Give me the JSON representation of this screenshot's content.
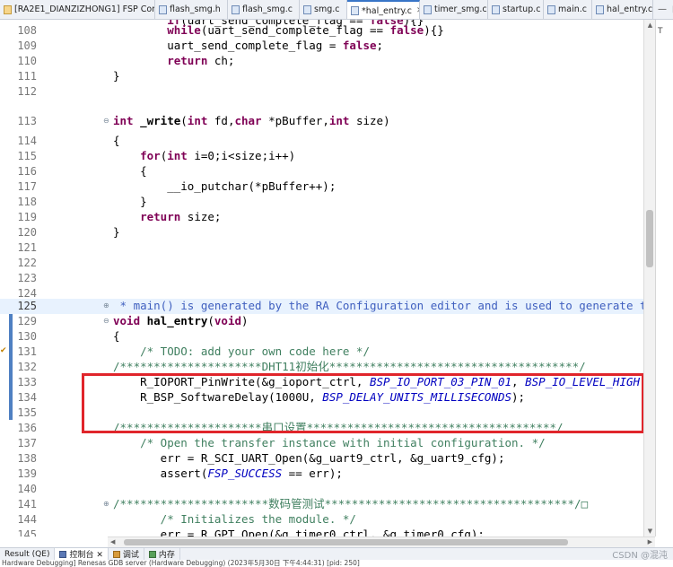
{
  "tabs": [
    {
      "label": "[RA2E1_DIANZIZHONG1] FSP Confi...",
      "icon": "config-icon",
      "active": false
    },
    {
      "label": "flash_smg.h",
      "icon": "c-header-icon",
      "active": false
    },
    {
      "label": "flash_smg.c",
      "icon": "c-file-icon",
      "active": false
    },
    {
      "label": "smg.c",
      "icon": "c-file-icon",
      "active": false
    },
    {
      "label": "*hal_entry.c",
      "icon": "c-file-icon",
      "active": true
    },
    {
      "label": "timer_smg.c",
      "icon": "c-file-icon",
      "active": false
    },
    {
      "label": "startup.c",
      "icon": "c-file-icon",
      "active": false
    },
    {
      "label": "main.c",
      "icon": "c-file-icon",
      "active": false
    },
    {
      "label": "hal_entry.c",
      "icon": "c-file-icon",
      "active": false
    }
  ],
  "tab_controls": {
    "minimize": "—",
    "maximize": "□"
  },
  "overview_label": "T",
  "code_lines": [
    {
      "num": "",
      "html_key": "l107"
    },
    {
      "num": "108"
    },
    {
      "num": "109"
    },
    {
      "num": "110"
    },
    {
      "num": "111"
    },
    {
      "num": "112"
    },
    {
      "num": ""
    },
    {
      "num": "113"
    },
    {
      "num": "114"
    },
    {
      "num": "115"
    },
    {
      "num": "116"
    },
    {
      "num": "117"
    },
    {
      "num": "118"
    },
    {
      "num": "119"
    },
    {
      "num": "120"
    },
    {
      "num": "121"
    },
    {
      "num": "122"
    },
    {
      "num": "123"
    },
    {
      "num": "124"
    },
    {
      "num": "125"
    },
    {
      "num": "129"
    },
    {
      "num": "130"
    },
    {
      "num": "131"
    },
    {
      "num": "132"
    },
    {
      "num": "133"
    },
    {
      "num": "134"
    },
    {
      "num": "135"
    },
    {
      "num": "136"
    },
    {
      "num": "137"
    },
    {
      "num": "138"
    },
    {
      "num": "139"
    },
    {
      "num": "140"
    },
    {
      "num": "141"
    },
    {
      "num": "144"
    },
    {
      "num": "145"
    }
  ],
  "code": {
    "l108": "        while(uart_send_complete_flag == false){}",
    "l109": "        uart_send_complete_flag = false;",
    "l110": "        return ch;",
    "l111": "}",
    "l113_kw1": "int",
    "l113_fn": " _write",
    "l113_a": "(",
    "l113_kw2": "int",
    "l113_b": " fd,",
    "l113_kw3": "char",
    "l113_c": " *pBuffer,",
    "l113_kw4": "int",
    "l113_d": " size)",
    "l114": "{",
    "l115_kw": "    for",
    "l115_a": "(",
    "l115_kw2": "int",
    "l115_b": " i=0;i<size;i++)",
    "l116": "    {",
    "l117": "        __io_putchar(*pBuffer++);",
    "l118": "    }",
    "l119_kw": "    return",
    "l119_b": " size;",
    "l120": "}",
    "l125": " * main() is generated by the RA Configuration editor and is used to generate th",
    "l129_kw": "void",
    "l129_fn": " hal_entry",
    "l129_a": "(",
    "l129_kw2": "void",
    "l129_b": ")",
    "l130": "{",
    "l131": "    /* TODO: add your own code here */",
    "l132": "/*********************DHT11初始化*************************************/",
    "l133_a": "    R_IOPORT_PinWrite(&g_ioport_ctrl, ",
    "l133_m1": "BSP_IO_PORT_03_PIN_01",
    "l133_b": ", ",
    "l133_m2": "BSP_IO_LEVEL_HIGH",
    "l133_c": ")",
    "l134_a": "    R_BSP_SoftwareDelay(1000U, ",
    "l134_m": "BSP_DELAY_UNITS_MILLISECONDS",
    "l134_b": ");",
    "l136": "/*********************串口设置*************************************/",
    "l137": "    /* Open the transfer instance with initial configuration. */",
    "l138": "       err = R_SCI_UART_Open(&g_uart9_ctrl, &g_uart9_cfg);",
    "l139_a": "       assert(",
    "l139_m": "FSP_SUCCESS",
    "l139_b": " == err);",
    "l141": "/**********************数码管测试*************************************/□",
    "l144": "       /* Initializes the module. */",
    "l145": "       err = R_GPT_Open(&g_timer0_ctrl, &g_timer0_cfg);"
  },
  "bottom_tabs": [
    {
      "label": "Result (QE)",
      "icon": "result-icon",
      "active": false
    },
    {
      "label": "控制台 ✕",
      "icon": "console-icon",
      "active": true
    },
    {
      "label": "调试",
      "icon": "debug-icon",
      "active": false
    },
    {
      "label": "内存",
      "icon": "memory-icon",
      "active": false
    }
  ],
  "watermark": "CSDN @混沌",
  "status_text": "Hardware Debugging] Renesas GDB server (Hardware Debugging) (2023年5月30日 下午4:44:31) [pid: 250]",
  "colors": {
    "accent": "#3875c7",
    "highlight_box": "#e0252b",
    "keyword": "#7f0055",
    "comment": "#3f7f5f",
    "macro": "#0000c0",
    "current_line": "#e8f2fe"
  }
}
